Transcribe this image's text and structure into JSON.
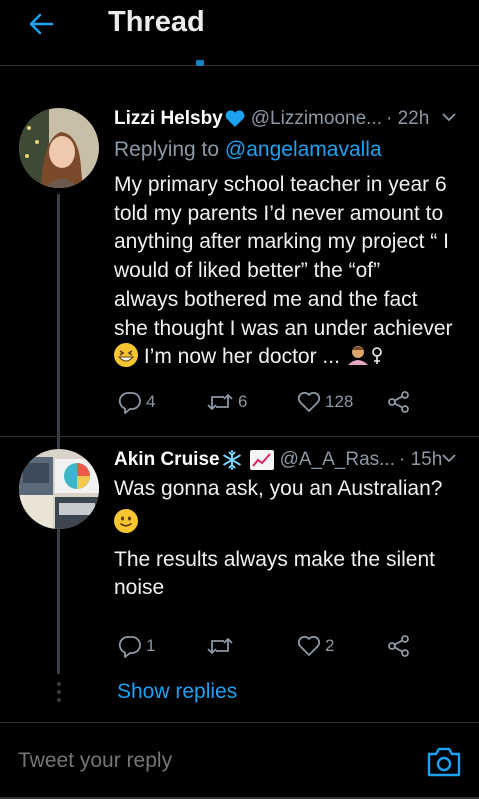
{
  "header": {
    "title": "Thread",
    "back_icon": "arrow-left-icon"
  },
  "tweets": [
    {
      "name": "Lizzi Helsby",
      "badge_icon": "blue-heart-icon",
      "handle": "@Lizzimoone...",
      "time": "· 22h",
      "replying_prefix": "Replying to",
      "replying_to": "@angelamavalla",
      "lines": [
        "My primary school teacher in year 6",
        "told my parents I’d never amount to",
        "anything after marking my project “ I",
        "would of liked better” the “of”",
        "always bothered me and the fact",
        "she thought I was an under achiever",
        "I’m now her doctor ..."
      ],
      "emojis": [
        "grinning-squint-face-icon",
        "woman-shrugging-icon"
      ],
      "replies": "4",
      "retweets": "6",
      "likes": "128"
    },
    {
      "name": "Akin Cruise",
      "badge_icons": [
        "snowflake-icon",
        "chart-increasing-icon"
      ],
      "handle": "@A_A_Ras...",
      "time": "· 15h",
      "line1": "Was gonna ask, you an Australian?",
      "emoji": "smiling-face-icon",
      "line2": "The results always make the silent",
      "line3": "noise",
      "replies": "1",
      "retweets": "",
      "likes": "2"
    }
  ],
  "show_replies": "Show replies",
  "composer": {
    "placeholder": "Tweet your reply",
    "camera_icon": "camera-icon"
  },
  "colors": {
    "accent": "#1da1f2",
    "muted": "#8b98a5",
    "background": "#000000",
    "divider": "#2f3336"
  }
}
